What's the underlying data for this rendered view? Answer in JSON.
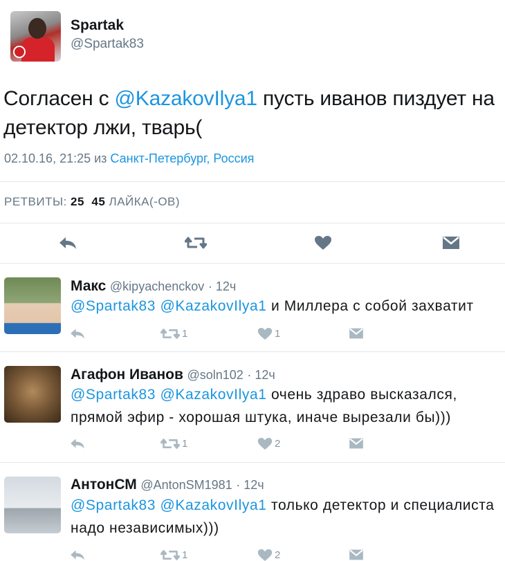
{
  "main_tweet": {
    "name": "Spartak",
    "handle": "@Spartak83",
    "text_before": "Согласен с ",
    "mention": "@KazakovIlya1",
    "text_after": " пусть иванов пиздует на детектор лжи, тварь(",
    "datetime": "02.10.16, 21:25 из ",
    "location": "Санкт-Петербург, Россия",
    "retweets_label": "РЕТВИТЫ:",
    "retweets_count": "25",
    "likes_count": "45",
    "likes_label": "ЛАЙКА(-ОВ)"
  },
  "replies": [
    {
      "name": "Макс",
      "handle": "@kipyachenckov",
      "time": "· 12ч",
      "mention1": "@Spartak83",
      "mention2": "@KazakovIlya1",
      "text": " и Миллера с собой захватит",
      "retweets": "1",
      "likes": "1"
    },
    {
      "name": "Агафон Иванов",
      "handle": "@soln102",
      "time": "· 12ч",
      "mention1": "@Spartak83",
      "mention2": "@KazakovIlya1",
      "text": " очень здраво высказался, прямой эфир - хорошая штука, иначе вырезали бы)))",
      "retweets": "1",
      "likes": "2"
    },
    {
      "name": "АнтонСМ",
      "handle": "@AntonSM1981",
      "time": "· 12ч",
      "mention1": "@Spartak83",
      "mention2": "@KazakovIlya1",
      "text": " только детектор и специалиста надо независимых)))",
      "retweets": "1",
      "likes": "2"
    }
  ],
  "colors": {
    "accent": "#1b95e0",
    "secondary_text": "#657786",
    "icon_main": "#657786",
    "icon_reply": "#aab8c2"
  }
}
